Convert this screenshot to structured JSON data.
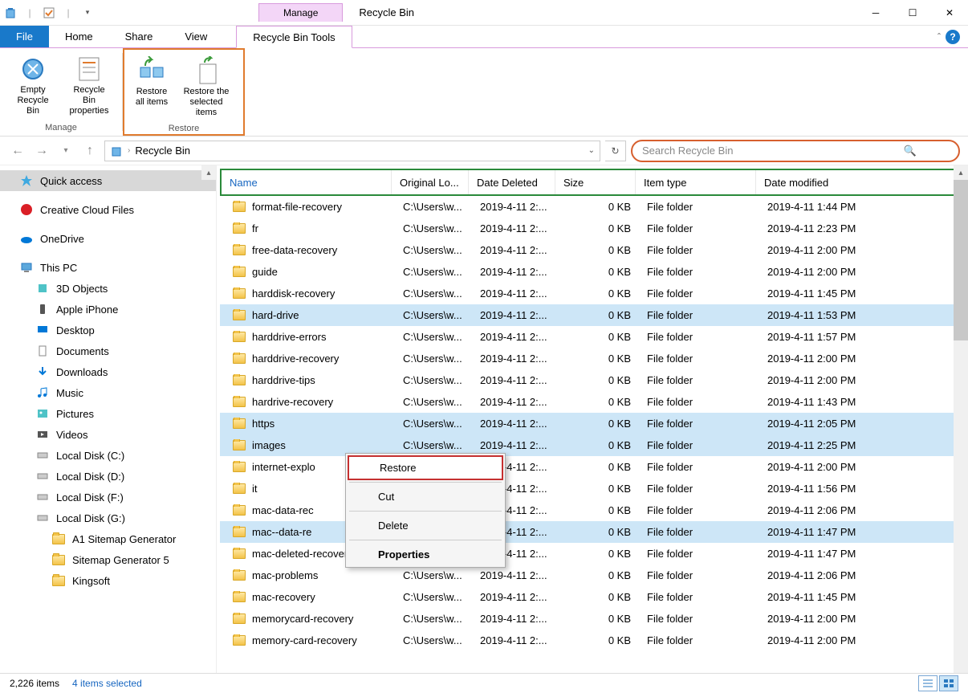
{
  "titlebar": {
    "manage": "Manage",
    "title": "Recycle Bin"
  },
  "tabs": {
    "file": "File",
    "home": "Home",
    "share": "Share",
    "view": "View",
    "tools": "Recycle Bin Tools"
  },
  "ribbon": {
    "manage_label": "Manage",
    "restore_label": "Restore",
    "empty": "Empty Recycle Bin",
    "props": "Recycle Bin properties",
    "restore_all": "Restore all items",
    "restore_sel": "Restore the selected items"
  },
  "nav": {
    "location": "Recycle Bin",
    "search_placeholder": "Search Recycle Bin"
  },
  "sidebar": [
    {
      "label": "Quick access",
      "icon": "star",
      "selected": true,
      "indent": 0
    },
    {
      "spacer": true
    },
    {
      "label": "Creative Cloud Files",
      "icon": "cc",
      "indent": 0
    },
    {
      "spacer": true
    },
    {
      "label": "OneDrive",
      "icon": "cloud",
      "indent": 0
    },
    {
      "spacer": true
    },
    {
      "label": "This PC",
      "icon": "pc",
      "indent": 0
    },
    {
      "label": "3D Objects",
      "icon": "3d",
      "indent": 1
    },
    {
      "label": "Apple iPhone",
      "icon": "phone",
      "indent": 1
    },
    {
      "label": "Desktop",
      "icon": "desktop",
      "indent": 1
    },
    {
      "label": "Documents",
      "icon": "docs",
      "indent": 1
    },
    {
      "label": "Downloads",
      "icon": "downloads",
      "indent": 1
    },
    {
      "label": "Music",
      "icon": "music",
      "indent": 1
    },
    {
      "label": "Pictures",
      "icon": "pictures",
      "indent": 1
    },
    {
      "label": "Videos",
      "icon": "videos",
      "indent": 1
    },
    {
      "label": "Local Disk (C:)",
      "icon": "disk",
      "indent": 1
    },
    {
      "label": "Local Disk (D:)",
      "icon": "disk",
      "indent": 1
    },
    {
      "label": "Local Disk (F:)",
      "icon": "disk",
      "indent": 1
    },
    {
      "label": "Local Disk (G:)",
      "icon": "disk",
      "indent": 1
    },
    {
      "label": "A1 Sitemap Generator",
      "icon": "folder",
      "indent": 2
    },
    {
      "label": "Sitemap Generator 5",
      "icon": "folder",
      "indent": 2
    },
    {
      "label": "Kingsoft",
      "icon": "folder",
      "indent": 2,
      "cut": true
    }
  ],
  "columns": {
    "name": "Name",
    "orig": "Original Lo...",
    "deleted": "Date Deleted",
    "size": "Size",
    "type": "Item type",
    "modified": "Date modified"
  },
  "rows": [
    {
      "name": "format-file-recovery",
      "orig": "C:\\Users\\w...",
      "deleted": "2019-4-11 2:...",
      "size": "0 KB",
      "type": "File folder",
      "modified": "2019-4-11 1:44 PM"
    },
    {
      "name": "fr",
      "orig": "C:\\Users\\w...",
      "deleted": "2019-4-11 2:...",
      "size": "0 KB",
      "type": "File folder",
      "modified": "2019-4-11 2:23 PM"
    },
    {
      "name": "free-data-recovery",
      "orig": "C:\\Users\\w...",
      "deleted": "2019-4-11 2:...",
      "size": "0 KB",
      "type": "File folder",
      "modified": "2019-4-11 2:00 PM"
    },
    {
      "name": "guide",
      "orig": "C:\\Users\\w...",
      "deleted": "2019-4-11 2:...",
      "size": "0 KB",
      "type": "File folder",
      "modified": "2019-4-11 2:00 PM"
    },
    {
      "name": "harddisk-recovery",
      "orig": "C:\\Users\\w...",
      "deleted": "2019-4-11 2:...",
      "size": "0 KB",
      "type": "File folder",
      "modified": "2019-4-11 1:45 PM"
    },
    {
      "name": "hard-drive",
      "orig": "C:\\Users\\w...",
      "deleted": "2019-4-11 2:...",
      "size": "0 KB",
      "type": "File folder",
      "modified": "2019-4-11 1:53 PM",
      "selected": true
    },
    {
      "name": "harddrive-errors",
      "orig": "C:\\Users\\w...",
      "deleted": "2019-4-11 2:...",
      "size": "0 KB",
      "type": "File folder",
      "modified": "2019-4-11 1:57 PM"
    },
    {
      "name": "harddrive-recovery",
      "orig": "C:\\Users\\w...",
      "deleted": "2019-4-11 2:...",
      "size": "0 KB",
      "type": "File folder",
      "modified": "2019-4-11 2:00 PM"
    },
    {
      "name": "harddrive-tips",
      "orig": "C:\\Users\\w...",
      "deleted": "2019-4-11 2:...",
      "size": "0 KB",
      "type": "File folder",
      "modified": "2019-4-11 2:00 PM"
    },
    {
      "name": "hardrive-recovery",
      "orig": "C:\\Users\\w...",
      "deleted": "2019-4-11 2:...",
      "size": "0 KB",
      "type": "File folder",
      "modified": "2019-4-11 1:43 PM"
    },
    {
      "name": "https",
      "orig": "C:\\Users\\w...",
      "deleted": "2019-4-11 2:...",
      "size": "0 KB",
      "type": "File folder",
      "modified": "2019-4-11 2:05 PM",
      "selected": true
    },
    {
      "name": "images",
      "orig": "C:\\Users\\w...",
      "deleted": "2019-4-11 2:...",
      "size": "0 KB",
      "type": "File folder",
      "modified": "2019-4-11 2:25 PM",
      "selected": true
    },
    {
      "name": "internet-explo",
      "orig": "",
      "deleted": "2019-4-11 2:...",
      "size": "0 KB",
      "type": "File folder",
      "modified": "2019-4-11 2:00 PM"
    },
    {
      "name": "it",
      "orig": "",
      "deleted": "2019-4-11 2:...",
      "size": "0 KB",
      "type": "File folder",
      "modified": "2019-4-11 1:56 PM"
    },
    {
      "name": "mac-data-rec",
      "orig": "",
      "deleted": "2019-4-11 2:...",
      "size": "0 KB",
      "type": "File folder",
      "modified": "2019-4-11 2:06 PM"
    },
    {
      "name": "mac--data-re",
      "orig": "",
      "deleted": "2019-4-11 2:...",
      "size": "0 KB",
      "type": "File folder",
      "modified": "2019-4-11 1:47 PM",
      "selected": true
    },
    {
      "name": "mac-deleted-recovery",
      "orig": "C:\\Users\\w...",
      "deleted": "2019-4-11 2:...",
      "size": "0 KB",
      "type": "File folder",
      "modified": "2019-4-11 1:47 PM"
    },
    {
      "name": "mac-problems",
      "orig": "C:\\Users\\w...",
      "deleted": "2019-4-11 2:...",
      "size": "0 KB",
      "type": "File folder",
      "modified": "2019-4-11 2:06 PM"
    },
    {
      "name": "mac-recovery",
      "orig": "C:\\Users\\w...",
      "deleted": "2019-4-11 2:...",
      "size": "0 KB",
      "type": "File folder",
      "modified": "2019-4-11 1:45 PM"
    },
    {
      "name": "memorycard-recovery",
      "orig": "C:\\Users\\w...",
      "deleted": "2019-4-11 2:...",
      "size": "0 KB",
      "type": "File folder",
      "modified": "2019-4-11 2:00 PM"
    },
    {
      "name": "memory-card-recovery",
      "orig": "C:\\Users\\w...",
      "deleted": "2019-4-11 2:...",
      "size": "0 KB",
      "type": "File folder",
      "modified": "2019-4-11 2:00 PM"
    }
  ],
  "context": {
    "restore": "Restore",
    "cut": "Cut",
    "delete": "Delete",
    "properties": "Properties"
  },
  "status": {
    "count": "2,226 items",
    "selected": "4 items selected"
  }
}
